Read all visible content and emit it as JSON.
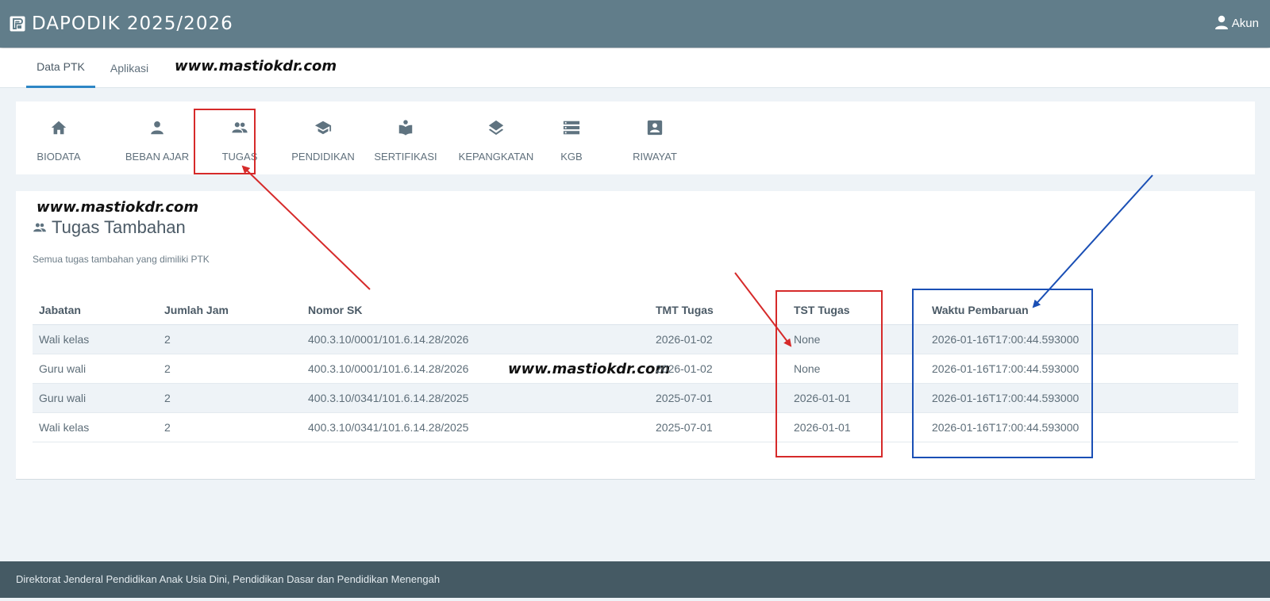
{
  "header": {
    "app_title": "DAPODIK 2025/2026",
    "account_label": "Akun"
  },
  "subnav": {
    "tabs": [
      {
        "label": "Data PTK",
        "active": true
      },
      {
        "label": "Aplikasi",
        "active": false
      }
    ]
  },
  "watermark": "www.mastiokdr.com",
  "menu": {
    "items": [
      {
        "label": "BIODATA",
        "icon": "home-icon"
      },
      {
        "label": "BEBAN AJAR",
        "icon": "person-icon"
      },
      {
        "label": "TUGAS",
        "icon": "people-icon"
      },
      {
        "label": "PENDIDIKAN",
        "icon": "graduation-cap-icon"
      },
      {
        "label": "SERTIFIKASI",
        "icon": "book-reader-icon"
      },
      {
        "label": "KEPANGKATAN",
        "icon": "layers-icon"
      },
      {
        "label": "KGB",
        "icon": "list-icon"
      },
      {
        "label": "RIWAYAT",
        "icon": "contact-card-icon"
      }
    ]
  },
  "section": {
    "title": "Tugas Tambahan",
    "description": "Semua tugas tambahan yang dimiliki PTK"
  },
  "table": {
    "columns": [
      "Jabatan",
      "Jumlah Jam",
      "Nomor SK",
      "TMT Tugas",
      "TST Tugas",
      "Waktu Pembaruan"
    ],
    "rows": [
      [
        "Wali kelas",
        "2",
        "400.3.10/0001/101.6.14.28/2026",
        "2026-01-02",
        "None",
        "2026-01-16T17:00:44.593000"
      ],
      [
        "Guru wali",
        "2",
        "400.3.10/0001/101.6.14.28/2026",
        "2026-01-02",
        "None",
        "2026-01-16T17:00:44.593000"
      ],
      [
        "Guru wali",
        "2",
        "400.3.10/0341/101.6.14.28/2025",
        "2025-07-01",
        "2026-01-01",
        "2026-01-16T17:00:44.593000"
      ],
      [
        "Wali kelas",
        "2",
        "400.3.10/0341/101.6.14.28/2025",
        "2025-07-01",
        "2026-01-01",
        "2026-01-16T17:00:44.593000"
      ]
    ]
  },
  "footer": {
    "text": "Direktorat Jenderal Pendidikan Anak Usia Dini, Pendidikan Dasar dan Pendidikan Menengah"
  },
  "colors": {
    "header_bg": "#617d8a",
    "footer_bg": "#455a64",
    "annotation_red": "#d62a2a",
    "annotation_blue": "#1a4fb5"
  }
}
